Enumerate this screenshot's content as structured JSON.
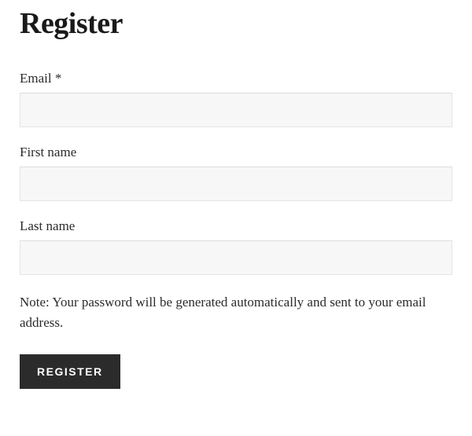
{
  "title": "Register",
  "fields": {
    "email": {
      "label": "Email",
      "required_mark": "*",
      "value": ""
    },
    "first_name": {
      "label": "First name",
      "value": ""
    },
    "last_name": {
      "label": "Last name",
      "value": ""
    }
  },
  "note": "Note: Your password will be generated automatically and sent to your email address.",
  "submit_label": "Register"
}
